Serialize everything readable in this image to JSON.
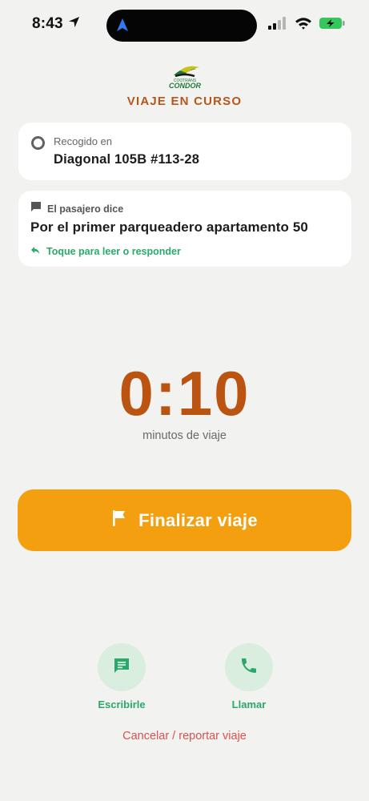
{
  "status_bar": {
    "time": "8:43",
    "icons": [
      "location-arrow-icon",
      "navigation-icon",
      "cellular-signal-icon",
      "wifi-icon",
      "battery-charging-icon"
    ]
  },
  "header": {
    "logo_name": "condor-logo",
    "logo_small_text": "COOTRANS",
    "logo_text": "CONDOR",
    "title": "VIAJE EN CURSO"
  },
  "pickup": {
    "label": "Recogido en",
    "address": "Diagonal 105B #113-28",
    "icon": "pickup-circle-icon"
  },
  "message": {
    "label": "El pasajero dice",
    "text": "Por el primer parqueadero apartamento 50",
    "reply_label": "Toque para leer o responder",
    "icon": "chat-bubble-icon",
    "reply_icon": "reply-arrow-icon"
  },
  "timer": {
    "value": "0:10",
    "caption": "minutos de viaje"
  },
  "finish_button": {
    "label": "Finalizar viaje",
    "icon": "flag-icon"
  },
  "actions": {
    "write_label": "Escribirle",
    "call_label": "Llamar",
    "write_icon": "message-icon",
    "call_icon": "phone-icon"
  },
  "cancel": {
    "label": "Cancelar / reportar viaje"
  },
  "colors": {
    "accent_orange": "#f39f10",
    "title_brown": "#b8561a",
    "timer_brown": "#bb5410",
    "green": "#2aa96a",
    "cancel_red": "#d9534f",
    "background": "#f2f2f0"
  }
}
